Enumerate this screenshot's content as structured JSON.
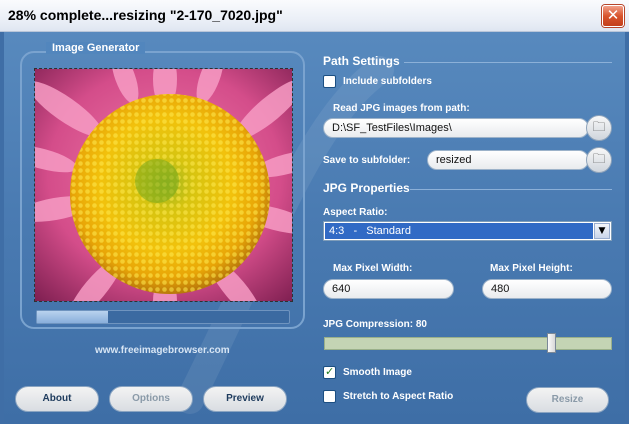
{
  "window": {
    "title": "28% complete...resizing \"2-170_7020.jpg\"",
    "close_icon": "close-icon"
  },
  "image_generator": {
    "group_label": "Image Generator",
    "progress_fraction": 0.28,
    "website": "www.freeimagebrowser.com"
  },
  "buttons": {
    "about": "About",
    "options": "Options",
    "preview": "Preview",
    "resize": "Resize"
  },
  "path_settings": {
    "heading": "Path Settings",
    "include_subfolders_label": "Include subfolders",
    "include_subfolders_checked": false,
    "read_path_label": "Read JPG images from path:",
    "read_path_value": "D:\\SF_TestFiles\\Images\\",
    "save_subfolder_label": "Save to subfolder:",
    "save_subfolder_value": "resized"
  },
  "jpg_properties": {
    "heading": "JPG Properties",
    "aspect_ratio_label": "Aspect Ratio:",
    "aspect_ratio_value": "4:3   -   Standard",
    "max_width_label": "Max Pixel Width:",
    "max_width_value": "640",
    "max_height_label": "Max Pixel Height:",
    "max_height_value": "480",
    "compression_label": "JPG Compression:",
    "compression_value": "80",
    "smooth_image_label": "Smooth Image",
    "smooth_image_checked": true,
    "stretch_label": "Stretch to Aspect Ratio",
    "stretch_checked": false
  },
  "colors": {
    "background": "#4a7bb2",
    "selection": "#316ac5",
    "close_button": "#d8542d"
  }
}
